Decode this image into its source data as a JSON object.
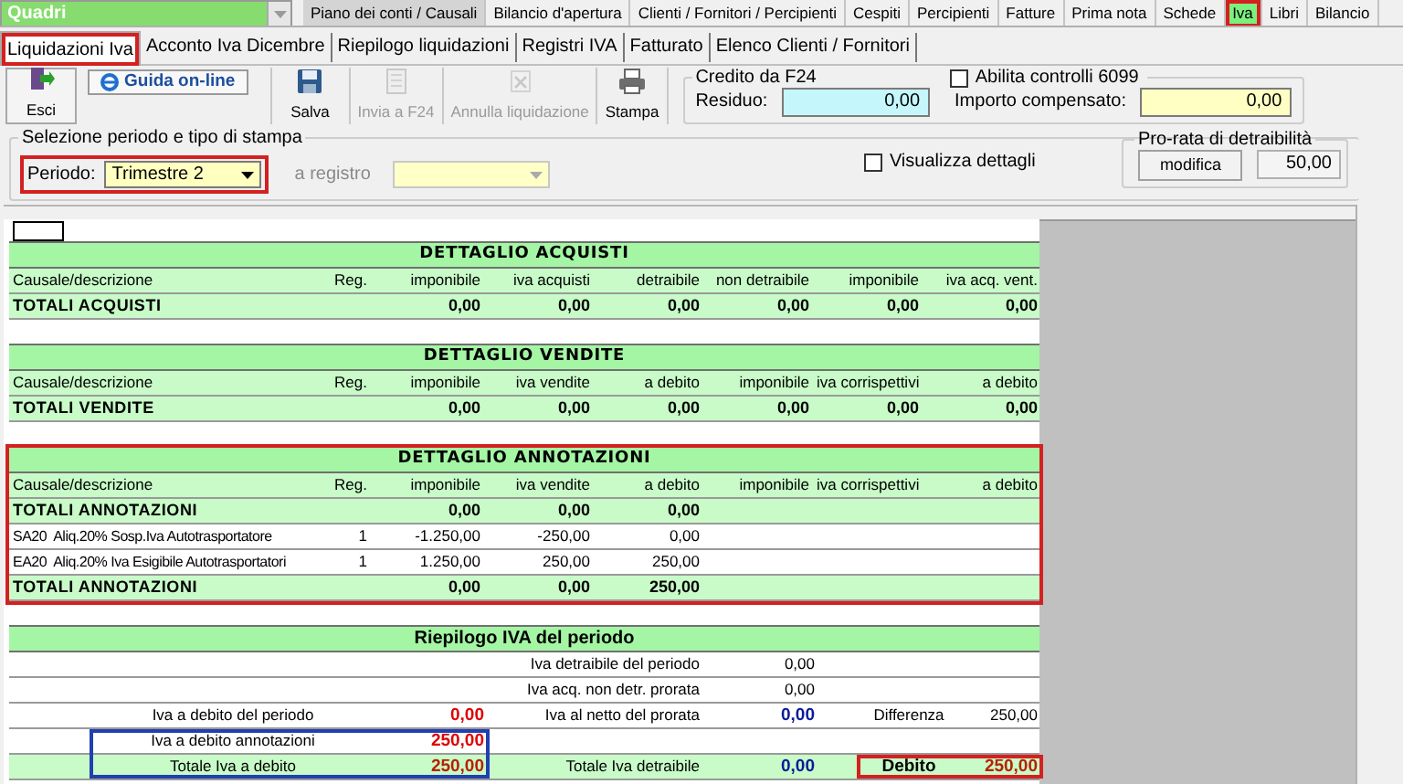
{
  "top_menu": {
    "module": "Quadri",
    "tabs": [
      {
        "label": "Piano dei conti / Causali",
        "selected": false
      },
      {
        "label": "Bilancio d'apertura",
        "selected": false
      },
      {
        "label": "Clienti / Fornitori / Percipienti",
        "selected": false
      },
      {
        "label": "Cespiti",
        "selected": false
      },
      {
        "label": "Percipienti",
        "selected": false
      },
      {
        "label": "Fatture",
        "selected": false
      },
      {
        "label": "Prima nota",
        "selected": false
      },
      {
        "label": "Schede",
        "selected": false
      },
      {
        "label": "Iva",
        "selected": true,
        "frame": {
          "color": "#d42020"
        }
      },
      {
        "label": "Libri",
        "selected": false
      },
      {
        "label": "Bilancio",
        "selected": false
      }
    ]
  },
  "sub_tabs": [
    {
      "label": "Liquidazioni Iva",
      "selected": true,
      "frame": {
        "color": "#d42020"
      }
    },
    {
      "label": "Acconto Iva Dicembre",
      "selected": false
    },
    {
      "label": "Riepilogo liquidazioni",
      "selected": false
    },
    {
      "label": "Registri IVA",
      "selected": false
    },
    {
      "label": "Fatturato",
      "selected": false
    },
    {
      "label": "Elenco Clienti / Fornitori",
      "selected": false
    }
  ],
  "toolbar": [
    {
      "kind": "exit",
      "label": "Esci",
      "disabled": false
    },
    {
      "kind": "help",
      "label": "Guida on-line",
      "disabled": false
    },
    {
      "kind": "save",
      "label": "Salva",
      "disabled": false
    },
    {
      "kind": "send",
      "label": "Invia a F24",
      "disabled": true
    },
    {
      "kind": "cancel",
      "label": "Annulla liquidazione",
      "disabled": true
    },
    {
      "kind": "print",
      "label": "Stampa",
      "disabled": false
    }
  ],
  "credito_f24": {
    "title": "Credito da F24",
    "residuo_label": "Residuo:",
    "residuo": "0,00",
    "check": {
      "label": "Abilita controlli 6099",
      "checked": false
    },
    "compensato_label": "Importo compensato:",
    "compensato": "0,00"
  },
  "selection": {
    "title": "Selezione periodo e tipo di stampa",
    "periodo_label": "Periodo:",
    "periodo": "Trimestre 2",
    "periodo_frame": {
      "color": "#d42020"
    },
    "registro_label": "a registro",
    "registro_disabled": true,
    "dettagli": {
      "label": "Visualizza dettagli",
      "checked": false
    },
    "prorata": {
      "title": "Pro-rata di detraibilità",
      "button": "modifica",
      "value": "50,00"
    }
  },
  "sections": [
    {
      "title": "DETTAGLIO ACQUISTI",
      "columns": [
        "Causale/descrizione",
        "Reg.",
        "imponibile",
        "iva acquisti",
        "detraibile",
        "non detraibile",
        "imponibile",
        "iva acq. vent."
      ],
      "rows": [
        {
          "kind": "total",
          "cells": [
            "TOTALI ACQUISTI",
            null,
            "0,00",
            "0,00",
            "0,00",
            "0,00",
            "0,00",
            "0,00"
          ]
        }
      ]
    },
    {
      "title": "DETTAGLIO VENDITE",
      "columns": [
        "Causale/descrizione",
        "Reg.",
        "imponibile",
        "iva vendite",
        "a debito",
        "imponibile",
        "iva corrispettivi",
        "a debito"
      ],
      "rows": [
        {
          "kind": "total",
          "cells": [
            "TOTALI VENDITE",
            null,
            "0,00",
            "0,00",
            "0,00",
            "0,00",
            "0,00",
            "0,00"
          ]
        }
      ]
    },
    {
      "title": "DETTAGLIO ANNOTAZIONI",
      "frame": {
        "color": "#d42020"
      },
      "columns": [
        "Causale/descrizione",
        "Reg.",
        "imponibile",
        "iva vendite",
        "a debito",
        "imponibile",
        "iva corrispettivi",
        "a debito"
      ],
      "rows": [
        {
          "kind": "total",
          "cells": [
            "TOTALI ANNOTAZIONI",
            null,
            "0,00",
            "0,00",
            "0,00",
            null,
            null,
            null
          ]
        },
        {
          "kind": "detail",
          "cells": [
            "SA20  Aliq.20% Sosp.Iva Autotrasportatore",
            "1",
            "-1.250,00",
            "-250,00",
            "0,00",
            null,
            null,
            null
          ]
        },
        {
          "kind": "detail",
          "cells": [
            "EA20  Aliq.20% Iva Esigibile Autotrasportatori",
            "1",
            "1.250,00",
            "250,00",
            "250,00",
            null,
            null,
            null
          ]
        },
        {
          "kind": "total",
          "cells": [
            "TOTALI ANNOTAZIONI",
            null,
            "0,00",
            "0,00",
            "250,00",
            null,
            null,
            null
          ]
        }
      ]
    }
  ],
  "riepilogo": {
    "title": "Riepilogo IVA del periodo",
    "rows": [
      {
        "kind": "detail",
        "mid_label": "Iva detraibile del periodo",
        "mid_value": {
          "text": "0,00",
          "kind": "plain"
        }
      },
      {
        "kind": "detail",
        "mid_label": "Iva acq. non detr. prorata",
        "mid_value": {
          "text": "0,00",
          "kind": "plain"
        }
      },
      {
        "kind": "detail",
        "left_label": "Iva a debito del periodo",
        "left_value": {
          "text": "0,00",
          "kind": "debit"
        },
        "mid_label": "Iva al netto del prorata",
        "mid_value": {
          "text": "0,00",
          "kind": "credit"
        },
        "right_label": "Differenza",
        "right_value": {
          "text": "250,00",
          "kind": "plain"
        }
      },
      {
        "kind": "detail",
        "left_label": "Iva a debito annotazioni",
        "left_value": {
          "text": "250,00",
          "kind": "debit"
        },
        "left_frame": {
          "color": "#2040b0"
        }
      },
      {
        "kind": "total",
        "left_label": "Totale Iva a debito",
        "left_value": {
          "text": "250,00",
          "kind": "debit"
        },
        "left_frame": {
          "color": "#2040b0"
        },
        "mid_label": "Totale Iva detraibile",
        "mid_value": {
          "text": "0,00",
          "kind": "credit"
        },
        "right_label": "Debito",
        "right_value": {
          "text": "250,00",
          "kind": "debit"
        },
        "right_frame": {
          "color": "#d42020"
        }
      }
    ]
  }
}
